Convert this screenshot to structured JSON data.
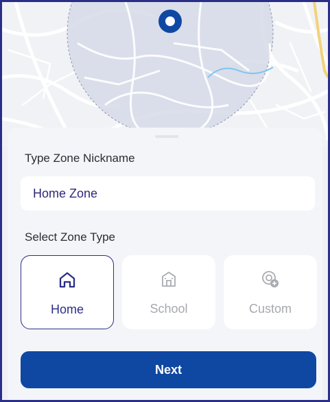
{
  "map": {
    "pin_icon": "location-pin-icon",
    "zone_fill": "#d5dbe8",
    "zone_border": "#8b93aa"
  },
  "form": {
    "nickname_label": "Type Zone Nickname",
    "nickname_value": "Home Zone",
    "zone_type_label": "Select Zone Type"
  },
  "zone_types": [
    {
      "name": "Home",
      "icon": "home-icon",
      "selected": true
    },
    {
      "name": "School",
      "icon": "school-icon",
      "selected": false
    },
    {
      "name": "Custom",
      "icon": "custom-location-icon",
      "selected": false
    }
  ],
  "actions": {
    "next_label": "Next"
  },
  "colors": {
    "primary": "#0f48a3",
    "selected_border": "#2a2e86",
    "frame_border": "#2a2e86",
    "disabled_text": "#a6a8ae"
  }
}
